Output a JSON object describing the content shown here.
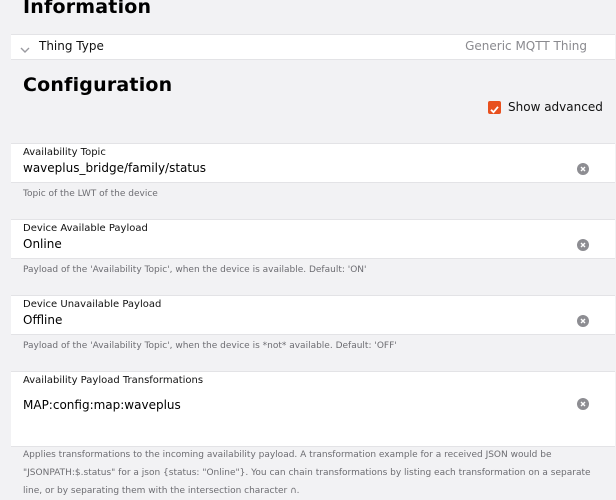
{
  "info": {
    "title": "Information",
    "thing_type_label": "Thing Type",
    "thing_type_value": "Generic MQTT Thing"
  },
  "config": {
    "title": "Configuration",
    "show_advanced_label": "Show advanced",
    "show_advanced_checked": true
  },
  "fields": [
    {
      "label": "Availability Topic",
      "value": "waveplus_bridge/family/status",
      "hint": "Topic of the LWT of the device"
    },
    {
      "label": "Device Available Payload",
      "value": "Online",
      "hint": "Payload of the 'Availability Topic', when the device is available. Default: 'ON'"
    },
    {
      "label": "Device Unavailable Payload",
      "value": "Offline",
      "hint": "Payload of the 'Availability Topic', when the device is *not* available. Default: 'OFF'"
    },
    {
      "label": "Availability Payload Transformations",
      "value": "MAP:config:map:waveplus",
      "hint": "Applies transformations to the incoming availability payload. A transformation example for a received JSON would be \"JSONPATH:$.status\" for a json {status: \"Online\"}. You can chain transformations by listing each transformation on a separate line, or by separating them with the intersection character ∩."
    }
  ],
  "colors": {
    "accent": "#e8501e",
    "background": "#f2f2f4",
    "card": "#ffffff"
  },
  "icons": {
    "chevron": "chevron-down-icon",
    "clear": "clear-icon",
    "check": "check-icon"
  }
}
